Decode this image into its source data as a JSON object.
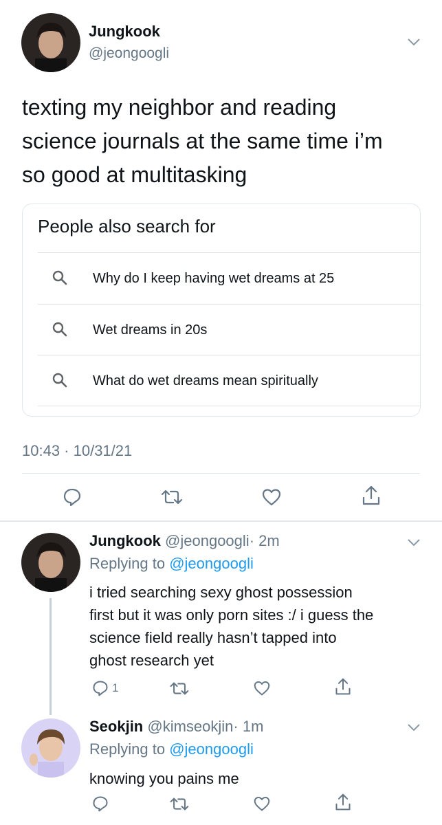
{
  "main_tweet": {
    "display_name": "Jungkook",
    "handle": "@jeongoogli",
    "text_lines": [
      "texting my neighbor and reading",
      "science journals at the same time i’m",
      "so good at multitasking"
    ],
    "search_card": {
      "title": "People also search for",
      "items": [
        "Why do I keep having wet dreams at 25",
        "Wet dreams in 20s",
        "What do wet dreams mean spiritually"
      ]
    },
    "timestamp": "10:43 · 10/31/21",
    "actions": [
      "reply-icon",
      "retweet-icon",
      "like-icon",
      "share-icon"
    ]
  },
  "replies": [
    {
      "display_name": "Jungkook",
      "handle": "@jeongoogli",
      "time": "· 2m",
      "replying_label": "Replying to",
      "replying_handle": "@jeongoogli",
      "text_lines": [
        "i tried searching sexy ghost possession",
        "first but it was only porn sites :/ i guess the",
        "science field really hasn’t tapped into",
        "ghost research yet"
      ],
      "reply_count": "1"
    },
    {
      "display_name": "Seokjin",
      "handle": "@kimseokjin",
      "time": "· 1m",
      "replying_label": "Replying to",
      "replying_handle": "@jeongoogli",
      "text_lines": [
        "knowing you pains me"
      ],
      "reply_count": ""
    }
  ],
  "colors": {
    "accent": "#1d9bf0",
    "secondary_text": "#657786",
    "divider": "#e1e8ed",
    "thread_line": "#c4cfd6"
  }
}
